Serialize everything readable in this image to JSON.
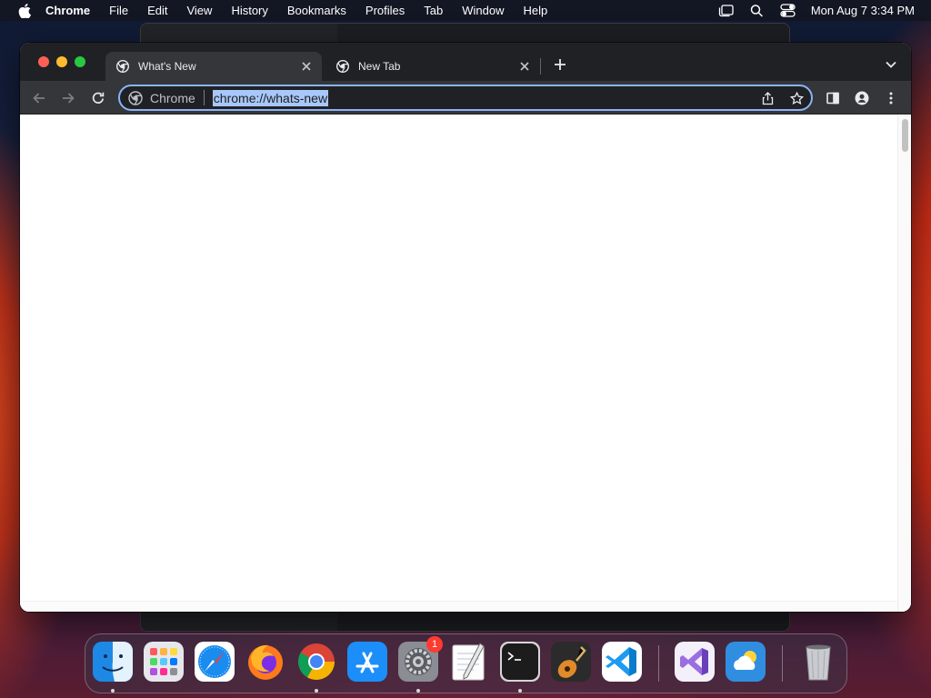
{
  "menubar": {
    "app_name": "Chrome",
    "items": [
      "File",
      "Edit",
      "View",
      "History",
      "Bookmarks",
      "Profiles",
      "Tab",
      "Window",
      "Help"
    ],
    "clock": "Mon Aug 7  3:34 PM"
  },
  "browser": {
    "tabs": [
      {
        "title": "What's New",
        "active": true
      },
      {
        "title": "New Tab",
        "active": false
      }
    ],
    "omnibox": {
      "chip_label": "Chrome",
      "url": "chrome://whats-new"
    }
  },
  "dock": {
    "apps": [
      "Finder",
      "Launchpad",
      "Safari",
      "Firefox",
      "Google Chrome",
      "App Store",
      "System Settings",
      "TextEdit",
      "Terminal",
      "GarageBand",
      "Visual Studio Code",
      "Visual Studio",
      "Weather",
      "Trash"
    ],
    "settings_badge": "1"
  },
  "colors": {
    "omnibox_focus": "#8ab4f8",
    "selection": "#a8c7fa",
    "tabstrip": "#202124",
    "toolbar": "#35363a"
  }
}
